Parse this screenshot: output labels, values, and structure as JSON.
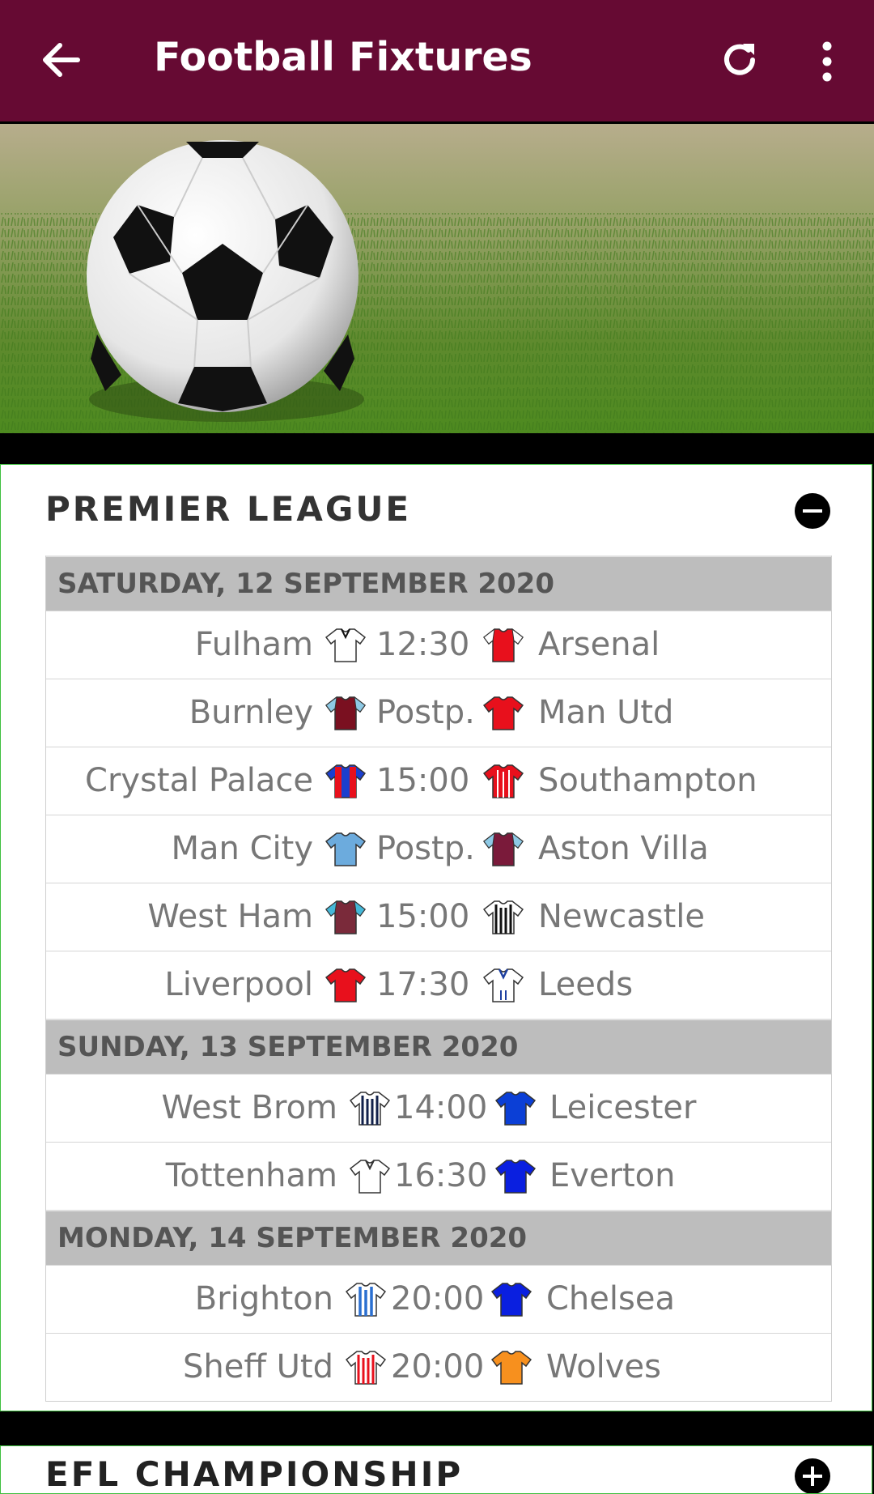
{
  "appbar": {
    "title": "Football Fixtures",
    "back_icon": "arrow-left-icon",
    "refresh_icon": "refresh-icon",
    "more_icon": "more-vertical-icon",
    "color": "#660a33"
  },
  "hero": {
    "image": "football-on-grass"
  },
  "league": {
    "name": "PREMIER LEAGUE",
    "toggle_icon": "minus-circle-icon",
    "days": [
      {
        "date": "SATURDAY, 12 SEPTEMBER 2020",
        "matches": [
          {
            "home": "Fulham",
            "time": "12:30",
            "away": "Arsenal"
          },
          {
            "home": "Burnley",
            "time": "Postp.",
            "away": "Man Utd"
          },
          {
            "home": "Crystal Palace",
            "time": "15:00",
            "away": "Southampton"
          },
          {
            "home": "Man City",
            "time": "Postp.",
            "away": "Aston Villa"
          },
          {
            "home": "West Ham",
            "time": "15:00",
            "away": "Newcastle"
          },
          {
            "home": "Liverpool",
            "time": "17:30",
            "away": "Leeds"
          }
        ]
      },
      {
        "date": "SUNDAY, 13 SEPTEMBER 2020",
        "matches": [
          {
            "home": "West Brom",
            "time": "14:00",
            "away": "Leicester"
          },
          {
            "home": "Tottenham",
            "time": "16:30",
            "away": "Everton"
          }
        ]
      },
      {
        "date": "MONDAY, 14 SEPTEMBER 2020",
        "matches": [
          {
            "home": "Brighton",
            "time": "20:00",
            "away": "Chelsea"
          },
          {
            "home": "Sheff Utd",
            "time": "20:00",
            "away": "Wolves"
          }
        ]
      }
    ]
  },
  "league2": {
    "name": "EFL CHAMPIONSHIP",
    "toggle_icon": "plus-circle-icon"
  }
}
